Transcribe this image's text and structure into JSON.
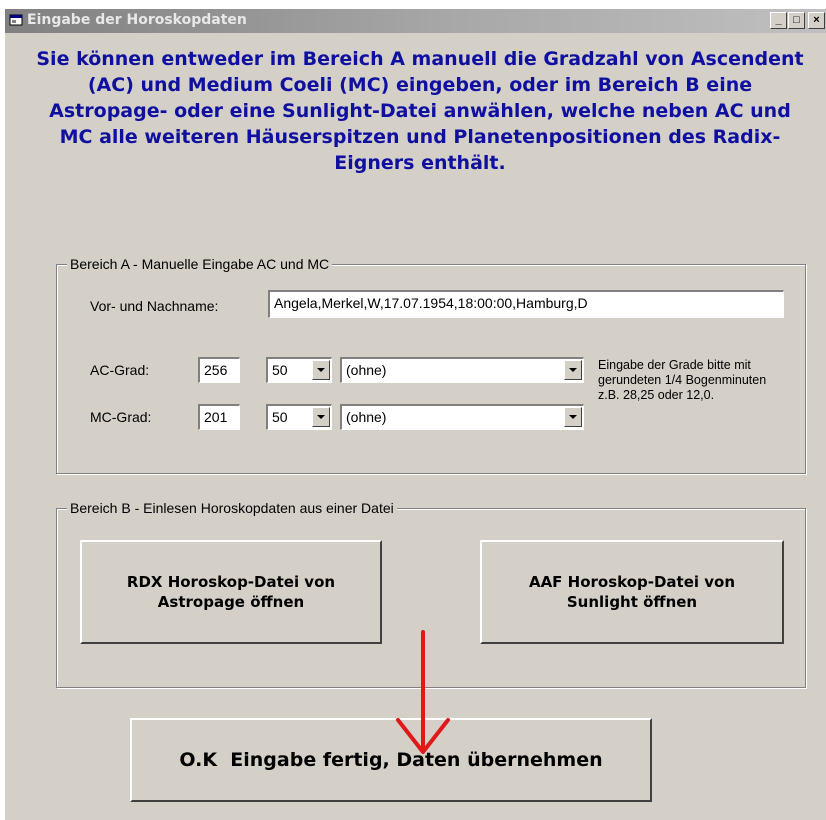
{
  "window": {
    "title": "Eingabe der Horoskopdaten",
    "controls": {
      "minimize": "_",
      "maximize": "□",
      "close": "×"
    }
  },
  "intro_text": "Sie können entweder im Bereich A manuell die Gradzahl von Ascendent (AC) und Medium Coeli (MC) eingeben, oder im Bereich B eine Astropage- oder eine Sunlight-Datei anwählen, welche neben AC und MC alle weiteren Häuserspitzen und Planetenpositionen des Radix-Eigners enthält.",
  "bereich_a": {
    "legend": "Bereich A - Manuelle Eingabe AC und MC",
    "name_label": "Vor- und Nachname:",
    "name_value": "Angela,Merkel,W,17.07.1954,18:00:00,Hamburg,D",
    "ac_label": "AC-Grad:",
    "ac_value": "256",
    "ac_minutes": "50",
    "ac_option": "(ohne)",
    "mc_label": "MC-Grad:",
    "mc_value": "201",
    "mc_minutes": "50",
    "mc_option": "(ohne)",
    "hint": "Eingabe der Grade bitte mit gerundeten 1/4 Bogenminuten z.B. 28,25 oder 12,0."
  },
  "bereich_b": {
    "legend": "Bereich B - Einlesen Horoskopdaten aus einer Datei",
    "rdx_button": [
      "RDX Horoskop-Datei von",
      "Astropage öffnen"
    ],
    "aaf_button": [
      "AAF Horoskop-Datei von",
      "Sunlight öffnen"
    ]
  },
  "ok_button": "O.K  Eingabe fertig, Daten übernehmen",
  "colors": {
    "intro_text": "#1010a0",
    "arrow": "#e01818",
    "dialog_bg": "#d4d0c8"
  }
}
